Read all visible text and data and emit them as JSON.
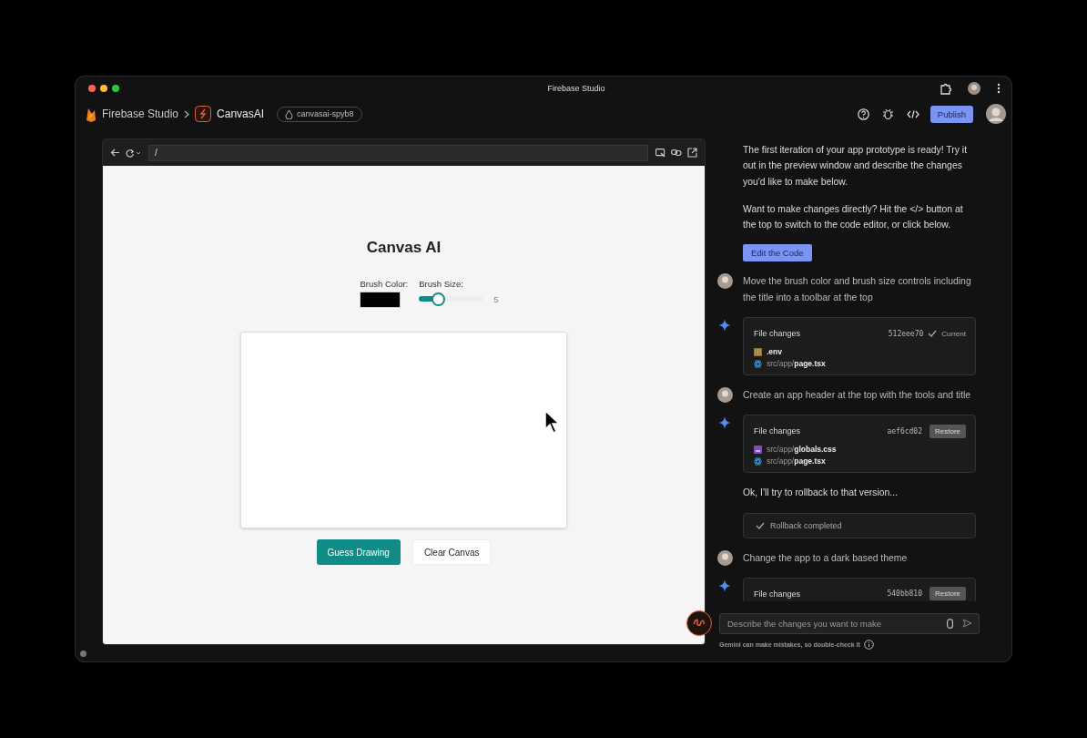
{
  "window": {
    "title": "Firebase Studio"
  },
  "header": {
    "breadcrumb": [
      "Firebase Studio",
      "CanvasAI"
    ],
    "project": "canvasai-spyb8",
    "publish": "Publish"
  },
  "preview": {
    "url": "/",
    "app": {
      "title": "Canvas AI",
      "brush_color_label": "Brush Color:",
      "brush_color_swatch": {
        "color": "#000000"
      },
      "brush_size_label": "Brush Size:",
      "brush_size": {
        "level": 0.28,
        "reading": "5"
      },
      "buttons": [
        {
          "label": "Guess Drawing",
          "kind": "primary"
        },
        {
          "label": "Clear Canvas",
          "kind": "secondary"
        }
      ]
    }
  },
  "chat": {
    "messages": [
      {
        "kind": "text",
        "text": "The first iteration of your app prototype is ready! Try it out in the preview window and describe the changes you'd like to make below."
      },
      {
        "kind": "text",
        "text": "Want to make changes directly? Hit the </> button at the top to switch to the code editor, or click below."
      },
      {
        "kind": "button",
        "text": "Edit the Code"
      },
      {
        "kind": "user",
        "text": "Move the brush color and brush size controls including the title into a toolbar at the top"
      },
      {
        "kind": "changes",
        "title": "File changes",
        "commit": "512eee70",
        "action": {
          "kind": "current",
          "label": "Current"
        },
        "files": [
          {
            "kind": "env",
            "name": ".env"
          },
          {
            "kind": "react",
            "dir": "src/app/",
            "name": "page.tsx"
          }
        ]
      },
      {
        "kind": "user",
        "text": "Create an app header at the top with the tools and title"
      },
      {
        "kind": "changes",
        "title": "File changes",
        "commit": "aef6cd02",
        "action": {
          "kind": "restore",
          "label": "Restore"
        },
        "files": [
          {
            "kind": "css",
            "dir": "src/app/",
            "name": "globals.css"
          },
          {
            "kind": "react",
            "dir": "src/app/",
            "name": "page.tsx"
          }
        ]
      },
      {
        "kind": "text",
        "text": "Ok, I'll try to rollback to that version..."
      },
      {
        "kind": "status",
        "text": "Rollback completed"
      },
      {
        "kind": "user",
        "text": "Change the app to a dark based theme"
      },
      {
        "kind": "changes",
        "title": "File changes",
        "commit": "540bb810",
        "action": {
          "kind": "restore",
          "label": "Restore"
        }
      }
    ],
    "input": {
      "placeholder": "Describe the changes you want to make"
    },
    "disclaimer": "Gemini can make mistakes, so double-check it"
  }
}
